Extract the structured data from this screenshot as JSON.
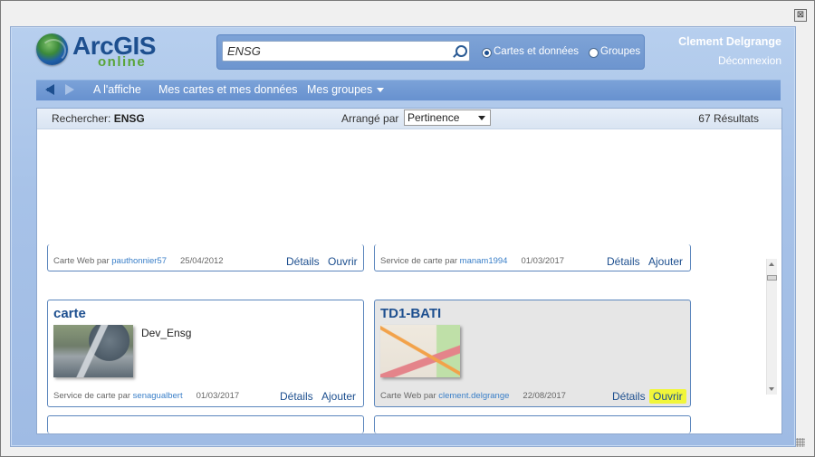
{
  "window": {
    "close_label": "⊠"
  },
  "logo": {
    "top": "ArcGIS",
    "bottom": "online"
  },
  "search": {
    "value": "ENSG",
    "option_maps": "Cartes et données",
    "option_groups": "Groupes",
    "selected": "maps"
  },
  "user": {
    "name": "Clement Delgrange",
    "logout": "Déconnexion"
  },
  "nav": {
    "featured": "A l'affiche",
    "my_content": "Mes cartes et mes données",
    "my_groups": "Mes groupes"
  },
  "results_bar": {
    "search_prefix": "Rechercher:",
    "query": "ENSG",
    "sort_label": "Arrangé par",
    "sort_value": "Pertinence",
    "count": "67 Résultats"
  },
  "partial_cards": [
    {
      "meta_type": "Carte Web par",
      "owner": "pauthonnier57",
      "date": "25/04/2012",
      "details": "Détails",
      "action": "Ouvrir"
    },
    {
      "meta_type": "Service de carte par",
      "owner": "manam1994",
      "date": "01/03/2017",
      "details": "Détails",
      "action": "Ajouter"
    }
  ],
  "cards": [
    {
      "title": "carte",
      "description": "Dev_Ensg",
      "meta_type": "Service de carte par",
      "owner": "senagualbert",
      "date": "01/03/2017",
      "details": "Détails",
      "action": "Ajouter"
    },
    {
      "title": "TD1-BATI",
      "description": "",
      "meta_type": "Carte Web par",
      "owner": "clement.delgrange",
      "date": "22/08/2017",
      "details": "Détails",
      "action": "Ouvrir"
    }
  ],
  "colors": {
    "highlight": "#f1f63a",
    "accent": "#1d4f8f",
    "frame": "#a7c2e8"
  }
}
